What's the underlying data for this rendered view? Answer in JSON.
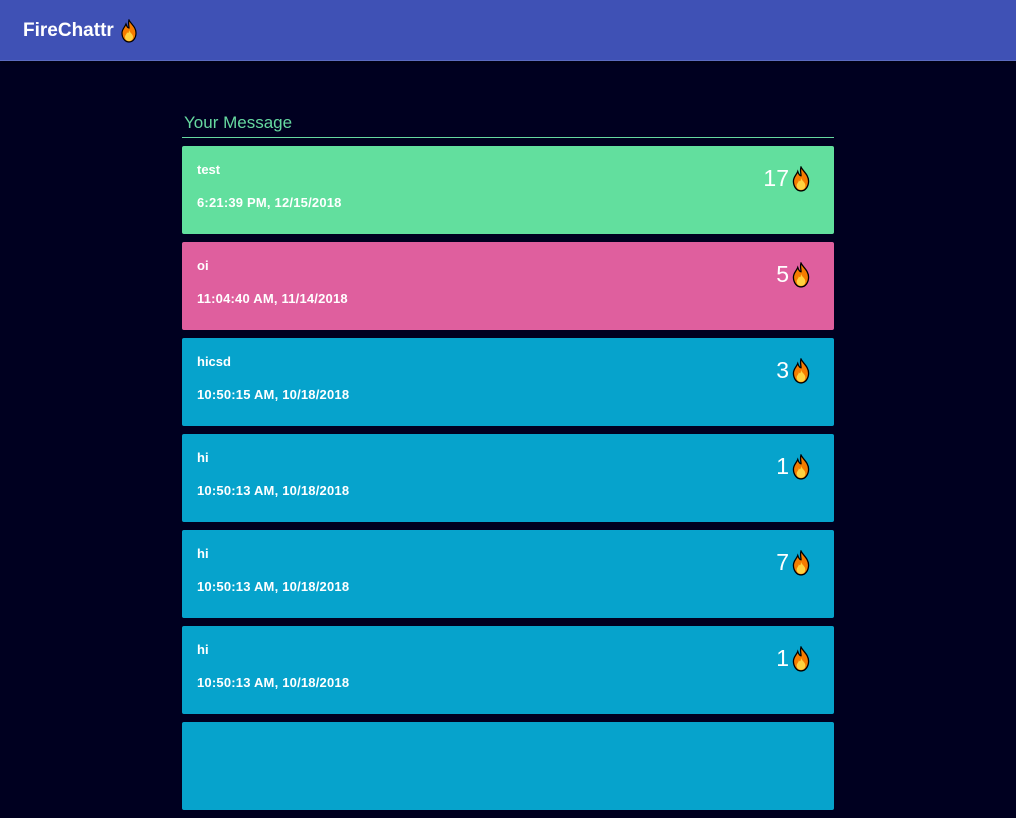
{
  "app": {
    "title": "FireChattr",
    "icon": "flame-icon",
    "header_color": "#3f51b5",
    "background_color": "#000020"
  },
  "section": {
    "label": "Your Message",
    "accent_color": "#66d9a0"
  },
  "messages": [
    {
      "text": "test",
      "timestamp": "6:21:39 PM, 12/15/2018",
      "fire_count": "17",
      "color": "#62df9e"
    },
    {
      "text": "oi",
      "timestamp": "11:04:40 AM, 11/14/2018",
      "fire_count": "5",
      "color": "#df5f9e"
    },
    {
      "text": "hicsd",
      "timestamp": "10:50:15 AM, 10/18/2018",
      "fire_count": "3",
      "color": "#06a3cc"
    },
    {
      "text": "hi",
      "timestamp": "10:50:13 AM, 10/18/2018",
      "fire_count": "1",
      "color": "#06a3cc"
    },
    {
      "text": "hi",
      "timestamp": "10:50:13 AM, 10/18/2018",
      "fire_count": "7",
      "color": "#06a3cc"
    },
    {
      "text": "hi",
      "timestamp": "10:50:13 AM, 10/18/2018",
      "fire_count": "1",
      "color": "#06a3cc"
    },
    {
      "text": "",
      "timestamp": "",
      "fire_count": "",
      "color": "#06a3cc"
    }
  ]
}
